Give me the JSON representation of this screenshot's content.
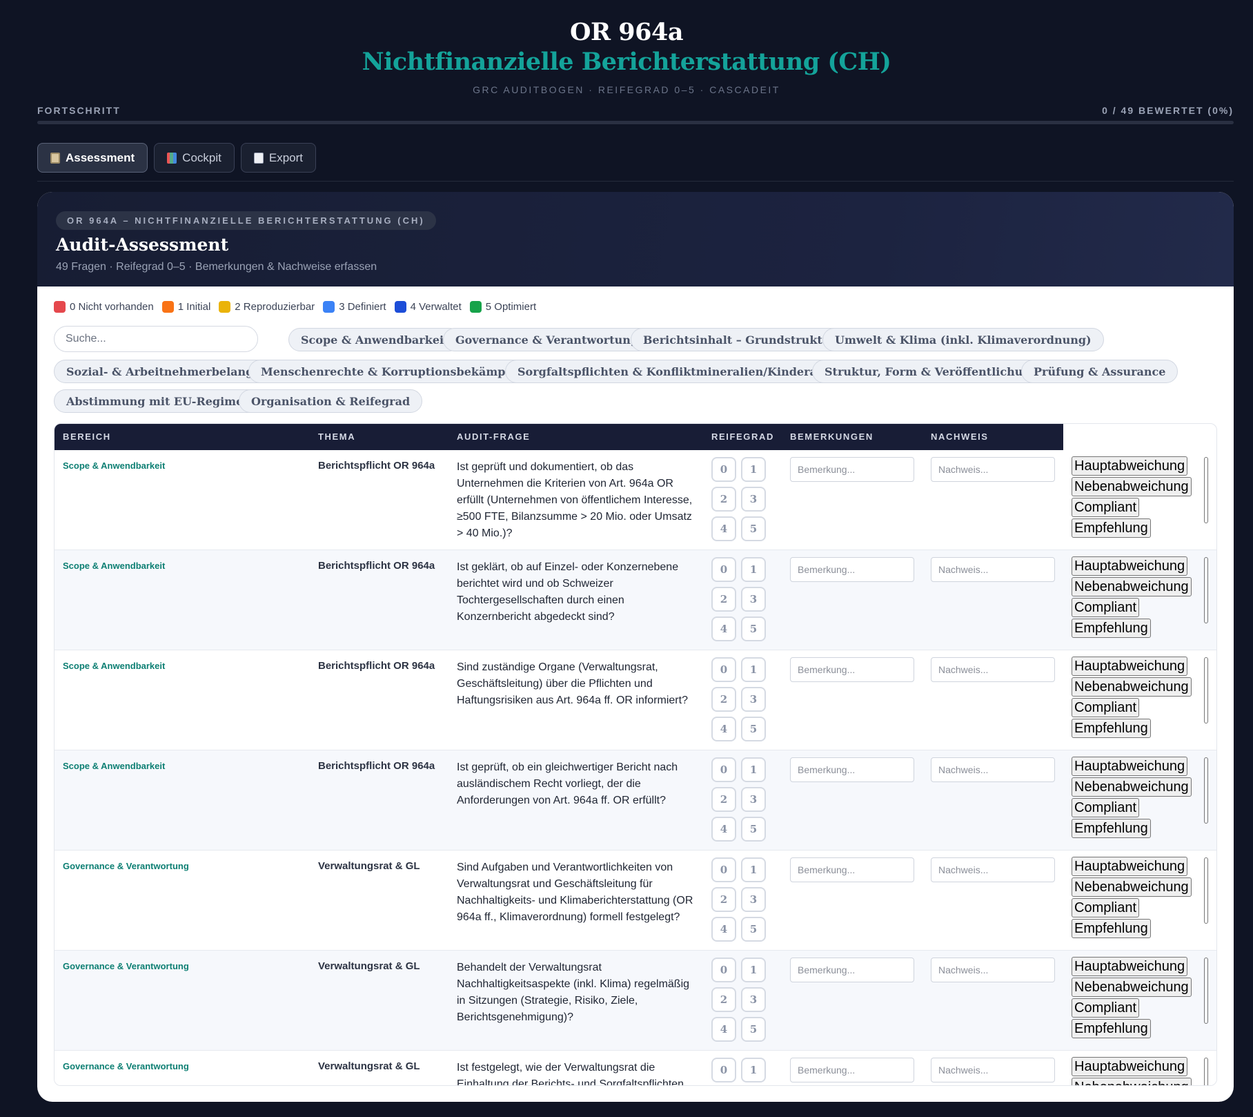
{
  "header": {
    "title": "OR 964a",
    "subtitle": "Nichtfinanzielle Berichterstattung (CH)",
    "meta": "GRC Auditbogen · Reifegrad 0–5 · Cascadeit"
  },
  "progress": {
    "label": "FORTSCHRITT",
    "count": "0 / 49 BEWERTET (0%)",
    "percent": 0,
    "color": "#14a39a"
  },
  "tabs": [
    {
      "label": "Assessment",
      "icon": "clipboard-icon",
      "active": true
    },
    {
      "label": "Cockpit",
      "icon": "bar-chart-icon",
      "active": false
    },
    {
      "label": "Export",
      "icon": "document-icon",
      "active": false
    }
  ],
  "card": {
    "chip": "OR 964a – Nichtfinanzielle Berichterstattung (CH)",
    "title": "Audit-Assessment",
    "subtitle": "49 Fragen · Reifegrad 0–5 · Bemerkungen & Nachweise erfassen"
  },
  "legend": [
    {
      "label": "0 Nicht vorhanden",
      "color": "#e5484d"
    },
    {
      "label": "1 Initial",
      "color": "#f97316"
    },
    {
      "label": "2 Reproduzierbar",
      "color": "#eab308"
    },
    {
      "label": "3 Definiert",
      "color": "#3b82f6"
    },
    {
      "label": "4 Verwaltet",
      "color": "#1d4ed8"
    },
    {
      "label": "5 Optimiert",
      "color": "#16a34a"
    }
  ],
  "search": {
    "placeholder": "Suche..."
  },
  "filters": [
    "Scope & Anwendbarkeit",
    "Governance & Verantwortung",
    "Berichtsinhalt – Grundstruktur",
    "Umwelt & Klima (inkl. Klimaverordnung)",
    "Sozial- & Arbeitnehmerbelange",
    "Menschenrechte & Korruptionsbekämpfung",
    "Sorgfaltspflichten & Konfliktmineralien/Kinderarbeit",
    "Struktur, Form & Veröffentlichung",
    "Prüfung & Assurance",
    "Abstimmung mit EU-Regimen",
    "Organisation & Reifegrad"
  ],
  "table": {
    "columns": [
      "BEREICH",
      "THEMA",
      "AUDIT-FRAGE",
      "REIFEGRAD",
      "BEMERKUNGEN",
      "NACHWEIS"
    ],
    "maturity_levels": [
      "0",
      "1",
      "2",
      "3",
      "4",
      "5"
    ],
    "remark_placeholder": "Bemerkung...",
    "evidence_placeholder": "Nachweis...",
    "flag_options": [
      "Hauptabweichung",
      "Nebenabweichung",
      "Compliant",
      "Empfehlung"
    ],
    "rows": [
      {
        "bereich": "Scope & Anwendbarkeit",
        "thema": "Berichtspflicht OR 964a",
        "frage": "Ist geprüft und dokumentiert, ob das Unternehmen die Kriterien von Art. 964a OR erfüllt (Unternehmen von öffentlichem Interesse, ≥500 FTE, Bilanzsumme > 20 Mio. oder Umsatz > 40 Mio.)?"
      },
      {
        "bereich": "Scope & Anwendbarkeit",
        "thema": "Berichtspflicht OR 964a",
        "frage": "Ist geklärt, ob auf Einzel- oder Konzernebene berichtet wird und ob Schweizer Tochtergesellschaften durch einen Konzernbericht abgedeckt sind?"
      },
      {
        "bereich": "Scope & Anwendbarkeit",
        "thema": "Berichtspflicht OR 964a",
        "frage": "Sind zuständige Organe (Verwaltungsrat, Geschäftsleitung) über die Pflichten und Haftungsrisiken aus Art. 964a ff. OR informiert?"
      },
      {
        "bereich": "Scope & Anwendbarkeit",
        "thema": "Berichtspflicht OR 964a",
        "frage": "Ist geprüft, ob ein gleichwertiger Bericht nach ausländischem Recht vorliegt, der die Anforderungen von Art. 964a ff. OR erfüllt?"
      },
      {
        "bereich": "Governance & Verantwortung",
        "thema": "Verwaltungsrat & GL",
        "frage": "Sind Aufgaben und Verantwortlichkeiten von Verwaltungsrat und Geschäftsleitung für Nachhaltigkeits- und Klimaberichterstattung (OR 964a ff., Klimaverordnung) formell festgelegt?"
      },
      {
        "bereich": "Governance & Verantwortung",
        "thema": "Verwaltungsrat & GL",
        "frage": "Behandelt der Verwaltungsrat Nachhaltigkeitsaspekte (inkl. Klima) regelmäßig in Sitzungen (Strategie, Risiko, Ziele, Berichtsgenehmigung)?"
      },
      {
        "bereich": "Governance & Verantwortung",
        "thema": "Verwaltungsrat & GL",
        "frage": "Ist festgelegt, wie der Verwaltungsrat die Einhaltung der Berichts- und Sorgfaltspflichten überwacht?"
      }
    ]
  }
}
